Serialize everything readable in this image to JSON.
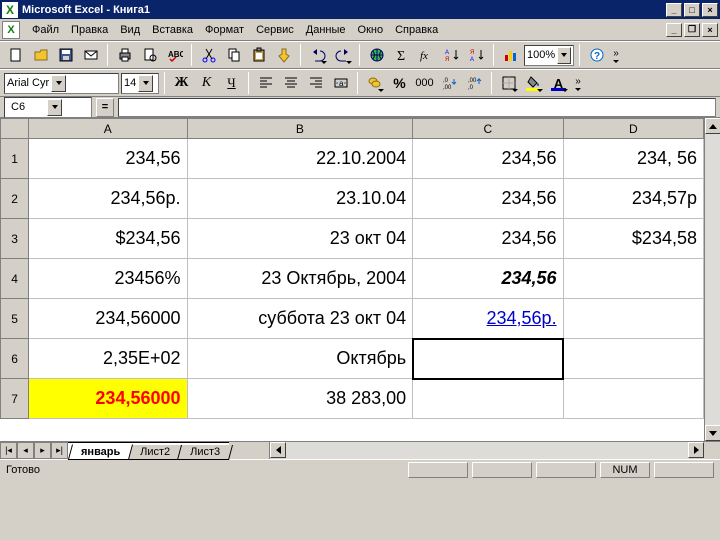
{
  "window": {
    "title": "Microsoft Excel - Книга1"
  },
  "menu": {
    "items": [
      "Файл",
      "Правка",
      "Вид",
      "Вставка",
      "Формат",
      "Сервис",
      "Данные",
      "Окно",
      "Справка"
    ]
  },
  "toolbar": {
    "zoom": "100%"
  },
  "format_bar": {
    "font_name": "Arial Cyr",
    "font_size": "14",
    "bold": "Ж",
    "italic": "К",
    "underline": "Ч"
  },
  "formula_bar": {
    "cell_ref": "C6",
    "value": ""
  },
  "columns": [
    "A",
    "B",
    "C",
    "D"
  ],
  "row_headers": [
    "1",
    "2",
    "3",
    "4",
    "5",
    "6",
    "7"
  ],
  "cells": {
    "A1": "234,56",
    "B1": "22.10.2004",
    "C1": "234,56",
    "D1": "234, 56",
    "A2": "234,56р.",
    "B2": "23.10.04",
    "C2": "234,56",
    "D2": "234,57р",
    "A3": "$234,56",
    "B3": "23 окт 04",
    "C3": "234,56",
    "D3": "$234,58",
    "A4": "23456%",
    "B4": "23 Октябрь, 2004",
    "C4": "234,56",
    "D4": "",
    "A5": "234,56000",
    "B5": "суббота 23 окт 04",
    "C5": "234,56р.",
    "D5": "",
    "A6": "2,35E+02",
    "B6": "Октябрь",
    "C6": "",
    "D6": "",
    "A7": "234,56000",
    "B7": "38 283,00",
    "C7": "",
    "D7": ""
  },
  "tabs": {
    "items": [
      "январь",
      "Лист2",
      "Лист3"
    ],
    "active": 0
  },
  "status": {
    "ready": "Готово",
    "num": "NUM"
  }
}
